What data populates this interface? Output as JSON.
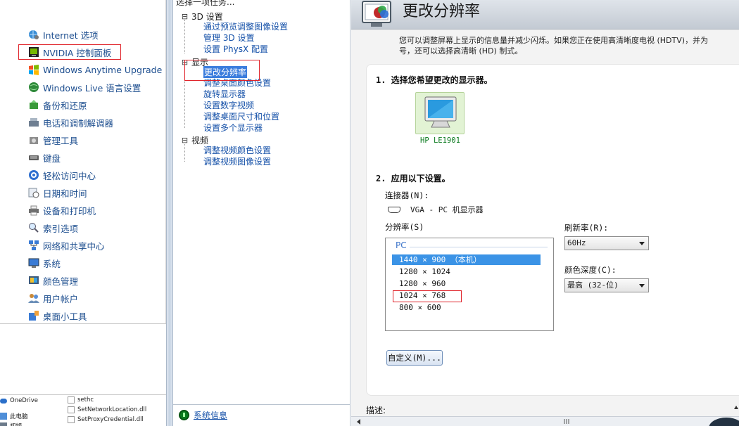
{
  "control_panel": {
    "items": [
      {
        "label": "Internet 选项",
        "icon": "globe-settings-icon"
      },
      {
        "label": "NVIDIA 控制面板",
        "icon": "nvidia-icon"
      },
      {
        "label": "Windows Anytime Upgrade",
        "icon": "windows-flag-icon"
      },
      {
        "label": "Windows Live 语言设置",
        "icon": "globe-icon"
      },
      {
        "label": "备份和还原",
        "icon": "backup-icon"
      },
      {
        "label": "电话和调制解调器",
        "icon": "phone-modem-icon"
      },
      {
        "label": "管理工具",
        "icon": "admin-tools-icon"
      },
      {
        "label": "键盘",
        "icon": "keyboard-icon"
      },
      {
        "label": "轻松访问中心",
        "icon": "accessibility-icon"
      },
      {
        "label": "日期和时间",
        "icon": "calendar-clock-icon"
      },
      {
        "label": "设备和打印机",
        "icon": "printer-icon"
      },
      {
        "label": "索引选项",
        "icon": "index-search-icon"
      },
      {
        "label": "网络和共享中心",
        "icon": "network-icon"
      },
      {
        "label": "系统",
        "icon": "system-icon"
      },
      {
        "label": "颜色管理",
        "icon": "color-management-icon"
      },
      {
        "label": "用户帐户",
        "icon": "user-accounts-icon"
      },
      {
        "label": "桌面小工具",
        "icon": "gadgets-icon"
      }
    ]
  },
  "explorer": {
    "left_items": [
      "OneDrive",
      "此电脑",
      "视频"
    ],
    "files": [
      "sethc",
      "SetNetworkLocation.dll",
      "SetProxyCredential.dll"
    ]
  },
  "task_tree": {
    "header": "选择一项任务...",
    "categories": [
      {
        "label": "3D 设置",
        "links": [
          "通过预览调整图像设置",
          "管理 3D 设置",
          "设置 PhysX 配置"
        ]
      },
      {
        "label": "显示",
        "links": [
          "更改分辨率",
          "调整桌面颜色设置",
          "旋转显示器",
          "设置数字视频",
          "调整桌面尺寸和位置",
          "设置多个显示器"
        ]
      },
      {
        "label": "视频",
        "links": [
          "调整视频颜色设置",
          "调整视频图像设置"
        ]
      }
    ],
    "toggle_symbol": "⊟",
    "system_info": "系统信息"
  },
  "main": {
    "title": "更改分辨率",
    "description_line1": "您可以调整屏幕上显示的信息量并减少闪烁。如果您正在使用高清晰度电视 (HDTV)，并为",
    "description_line2": "号，还可以选择高清晰 (HD) 制式。",
    "step1": "1. 选择您希望更改的显示器。",
    "monitor_name": "HP LE1901",
    "step2": "2. 应用以下设置。",
    "connector_label": "连接器(N):",
    "connector_value": "VGA - PC 机显示器",
    "resolution_label": "分辨率(S)",
    "resolution_group": "PC",
    "resolutions": [
      "1440 × 900 （本机）",
      "1280 × 1024",
      "1280 × 960",
      "1024 × 768",
      "800 × 600"
    ],
    "refresh_label": "刷新率(R):",
    "refresh_value": "60Hz",
    "color_depth_label": "颜色深度(C):",
    "color_depth_value": "最高 (32-位)",
    "custom_button": "自定义(M)...",
    "describe_label": "描述:"
  },
  "colors": {
    "link_blue": "#1450a8",
    "selection_blue": "#3b93e6",
    "highlight_red": "#e0242b",
    "nvidia_green": "#0a7a1e"
  }
}
